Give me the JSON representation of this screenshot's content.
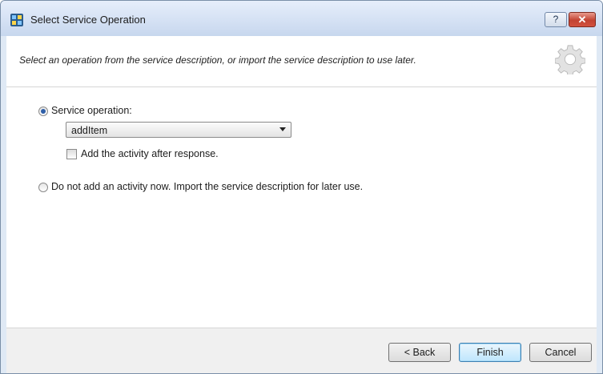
{
  "window": {
    "title": "Select Service Operation",
    "help_label": "?",
    "close_label": "✕"
  },
  "header": {
    "description": "Select an operation from the service description, or import the service description to use later."
  },
  "options": {
    "service_operation": {
      "label": "Service operation:",
      "selected": true,
      "combo_value": "addItem",
      "add_after_response_label": "Add the activity after response.",
      "add_after_response_checked": false
    },
    "import_only": {
      "label": "Do not add an activity now. Import the service description for later use.",
      "selected": false
    }
  },
  "footer": {
    "back_label": "< Back",
    "finish_label": "Finish",
    "cancel_label": "Cancel"
  },
  "colors": {
    "accent": "#2f5fa8",
    "close_red": "#c24332",
    "titlebar": "#c7d7ee"
  }
}
